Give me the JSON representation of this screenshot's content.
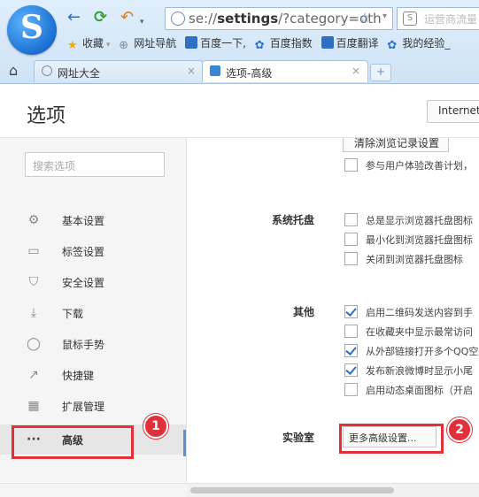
{
  "browser": {
    "logo": "S",
    "back_glyph": "←",
    "refresh_glyph": "⟳",
    "undo_glyph": "↶",
    "url_prefix": "se://",
    "url_bold": "settings",
    "url_rest": "/?category=oth",
    "search_placeholder": "运营商流量",
    "bookmarks": [
      {
        "label": "收藏",
        "icon": "star-icon",
        "color": "#f2a900"
      },
      {
        "label": "网址导航",
        "icon": "globe-icon",
        "color": "#7c8ea3"
      },
      {
        "label": "百度一下,",
        "icon": "paw-icon",
        "color": "#2f6fc4"
      },
      {
        "label": "百度指数",
        "icon": "paw-icon",
        "color": "#2f6fc4"
      },
      {
        "label": "百度翻译",
        "icon": "translate-icon",
        "color": "#2f6fc4"
      },
      {
        "label": "我的经验_",
        "icon": "paw-icon",
        "color": "#2f6fc4"
      }
    ],
    "tabs": [
      {
        "label": "网址大全",
        "close": "×"
      },
      {
        "label": "选项-高级",
        "close": "×"
      }
    ],
    "new_tab": "+"
  },
  "settings": {
    "title": "选项",
    "engine_button": "Internet",
    "search_placeholder": "搜索选项",
    "nav": [
      {
        "label": "基本设置",
        "icon": "gear-icon",
        "glyph": "⚙"
      },
      {
        "label": "标签设置",
        "icon": "tab-icon",
        "glyph": "▭"
      },
      {
        "label": "安全设置",
        "icon": "shield-icon",
        "glyph": "⛉"
      },
      {
        "label": "下载",
        "icon": "download-icon",
        "glyph": "⤓"
      },
      {
        "label": "鼠标手势",
        "icon": "mouse-icon",
        "glyph": "◯"
      },
      {
        "label": "快捷键",
        "icon": "shortcut-icon",
        "glyph": "↗"
      },
      {
        "label": "扩展管理",
        "icon": "extension-icon",
        "glyph": "▦"
      },
      {
        "label": "高级",
        "icon": "more-icon",
        "glyph": "···"
      }
    ],
    "content": {
      "clear_history_button": "清除浏览记录设置",
      "experience_plan": "参与用户体验改善计划，",
      "tray": {
        "label": "系统托盘",
        "options": [
          {
            "label": "总是显示浏览器托盘图标",
            "checked": false
          },
          {
            "label": "最小化到浏览器托盘图标",
            "checked": false
          },
          {
            "label": "关闭到浏览器托盘图标",
            "checked": false
          }
        ]
      },
      "other": {
        "label": "其他",
        "options": [
          {
            "label": "启用二维码发送内容到手",
            "checked": true
          },
          {
            "label": "在收藏夹中显示最常访问",
            "checked": false
          },
          {
            "label": "从外部链接打开多个QQ空",
            "checked": true
          },
          {
            "label": "发布新浪微博时显示小尾",
            "checked": true
          },
          {
            "label": "启用动态桌面图标（开启",
            "checked": false
          }
        ]
      },
      "lab": {
        "label": "实验室",
        "button": "更多高级设置..."
      }
    }
  },
  "annotations": {
    "badge1": "1",
    "badge2": "2",
    "color": "#e0313a"
  }
}
